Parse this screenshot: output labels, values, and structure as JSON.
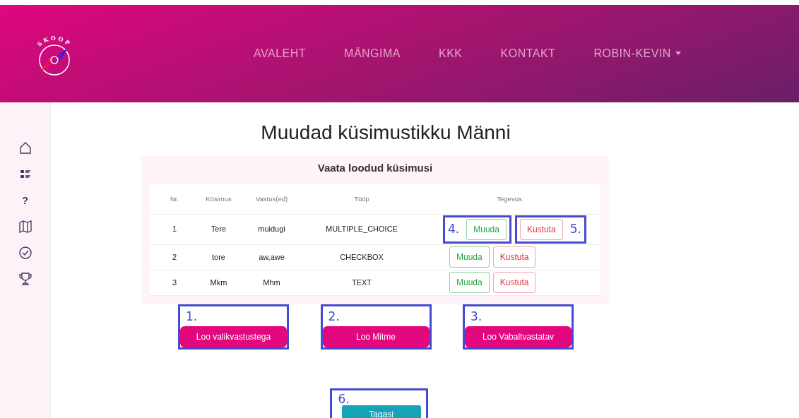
{
  "logo": {
    "text": "SKOOP"
  },
  "nav": [
    {
      "label": "AVALEHT",
      "dropdown": false
    },
    {
      "label": "MÄNGIMA",
      "dropdown": false
    },
    {
      "label": "KKK",
      "dropdown": false
    },
    {
      "label": "KONTAKT",
      "dropdown": false
    },
    {
      "label": "ROBIN-KEVIN",
      "dropdown": true
    }
  ],
  "sidebar": {
    "items": [
      {
        "kind": "home"
      },
      {
        "kind": "checklist"
      },
      {
        "kind": "glyph",
        "glyph": "?"
      },
      {
        "kind": "map"
      },
      {
        "kind": "check"
      },
      {
        "kind": "trophy"
      }
    ]
  },
  "title": "Muudad küsimustikku Männi",
  "panel": {
    "title": "Vaata loodud küsimusi",
    "table": {
      "columns": [
        "Nr.",
        "Küsimus",
        "Vastus(ed)",
        "Tüüp",
        "Tegevus"
      ],
      "rows": [
        {
          "cells": [
            "1",
            "Tere",
            "muidugi",
            "MULTIPLE_CHOICE"
          ],
          "edit": {
            "label": "Muuda",
            "annotation": "4."
          },
          "delete": {
            "label": "Kustuta",
            "annotation": "5."
          }
        },
        {
          "cells": [
            "2",
            "tore",
            "aw,awe",
            "CHECKBOX"
          ],
          "edit": {
            "label": "Muuda"
          },
          "delete": {
            "label": "Kustuta"
          }
        },
        {
          "cells": [
            "3",
            "Mkm",
            "Mhm",
            "TEXT"
          ],
          "edit": {
            "label": "Muuda"
          },
          "delete": {
            "label": "Kustuta"
          }
        }
      ]
    }
  },
  "create_buttons": [
    {
      "label": "Loo valikvastustega",
      "annotation": "1."
    },
    {
      "label": "Loo Mitme",
      "annotation": "2."
    },
    {
      "label": "Loo Vabaltvastatav",
      "annotation": "3."
    }
  ],
  "back_button": {
    "label": "Tagasi",
    "annotation": "6."
  }
}
